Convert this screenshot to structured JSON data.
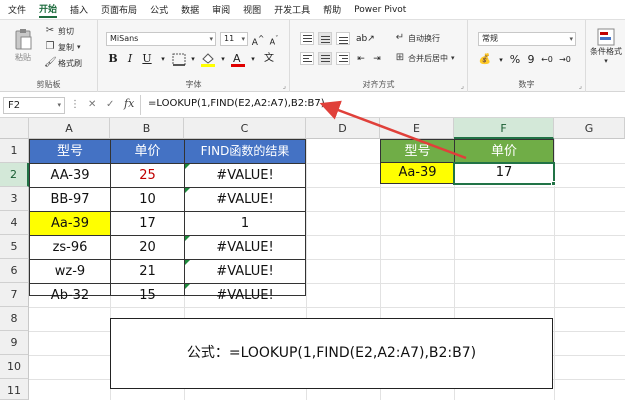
{
  "menu": [
    "文件",
    "开始",
    "插入",
    "页面布局",
    "公式",
    "数据",
    "审阅",
    "视图",
    "开发工具",
    "帮助",
    "Power Pivot"
  ],
  "ribbon": {
    "clipboard": {
      "paste": "粘贴",
      "cut": "剪切",
      "copy": "复制",
      "format_painter": "格式刷",
      "label": "剪贴板"
    },
    "font": {
      "name": "MiSans",
      "size": "11",
      "bold": "B",
      "italic": "I",
      "underline": "U",
      "label": "字体"
    },
    "alignment": {
      "wrap": "自动换行",
      "merge": "合并后居中",
      "label": "对齐方式"
    },
    "number": {
      "format": "常规",
      "label": "数字"
    },
    "styles": {
      "conditional": "条件格式"
    }
  },
  "formula_bar": {
    "name_box": "F2",
    "fx": "fx",
    "formula": "=LOOKUP(1,FIND(E2,A2:A7),B2:B7)"
  },
  "columns": [
    "A",
    "B",
    "C",
    "D",
    "E",
    "F",
    "G"
  ],
  "rows": [
    "1",
    "2",
    "3",
    "4",
    "5",
    "6",
    "7",
    "8",
    "9",
    "10",
    "11"
  ],
  "table1": {
    "headers": [
      "型号",
      "单价",
      "FIND函数的结果"
    ],
    "rows": [
      [
        "AA-39",
        "25",
        "#VALUE!"
      ],
      [
        "BB-97",
        "10",
        "#VALUE!"
      ],
      [
        "Aa-39",
        "17",
        "1"
      ],
      [
        "zs-96",
        "20",
        "#VALUE!"
      ],
      [
        "wz-9",
        "21",
        "#VALUE!"
      ],
      [
        "Ab-32",
        "15",
        "#VALUE!"
      ]
    ]
  },
  "table2": {
    "headers": [
      "型号",
      "单价"
    ],
    "row": [
      "Aa-39",
      "17"
    ]
  },
  "note": "公式：=LOOKUP(1,FIND(E2,A2:A7),B2:B7)",
  "colors": {
    "accent": "#217346",
    "header_blue": "#4472c4",
    "header_green": "#70ad47",
    "highlight": "#ffff00",
    "arrow": "#e0403a"
  }
}
